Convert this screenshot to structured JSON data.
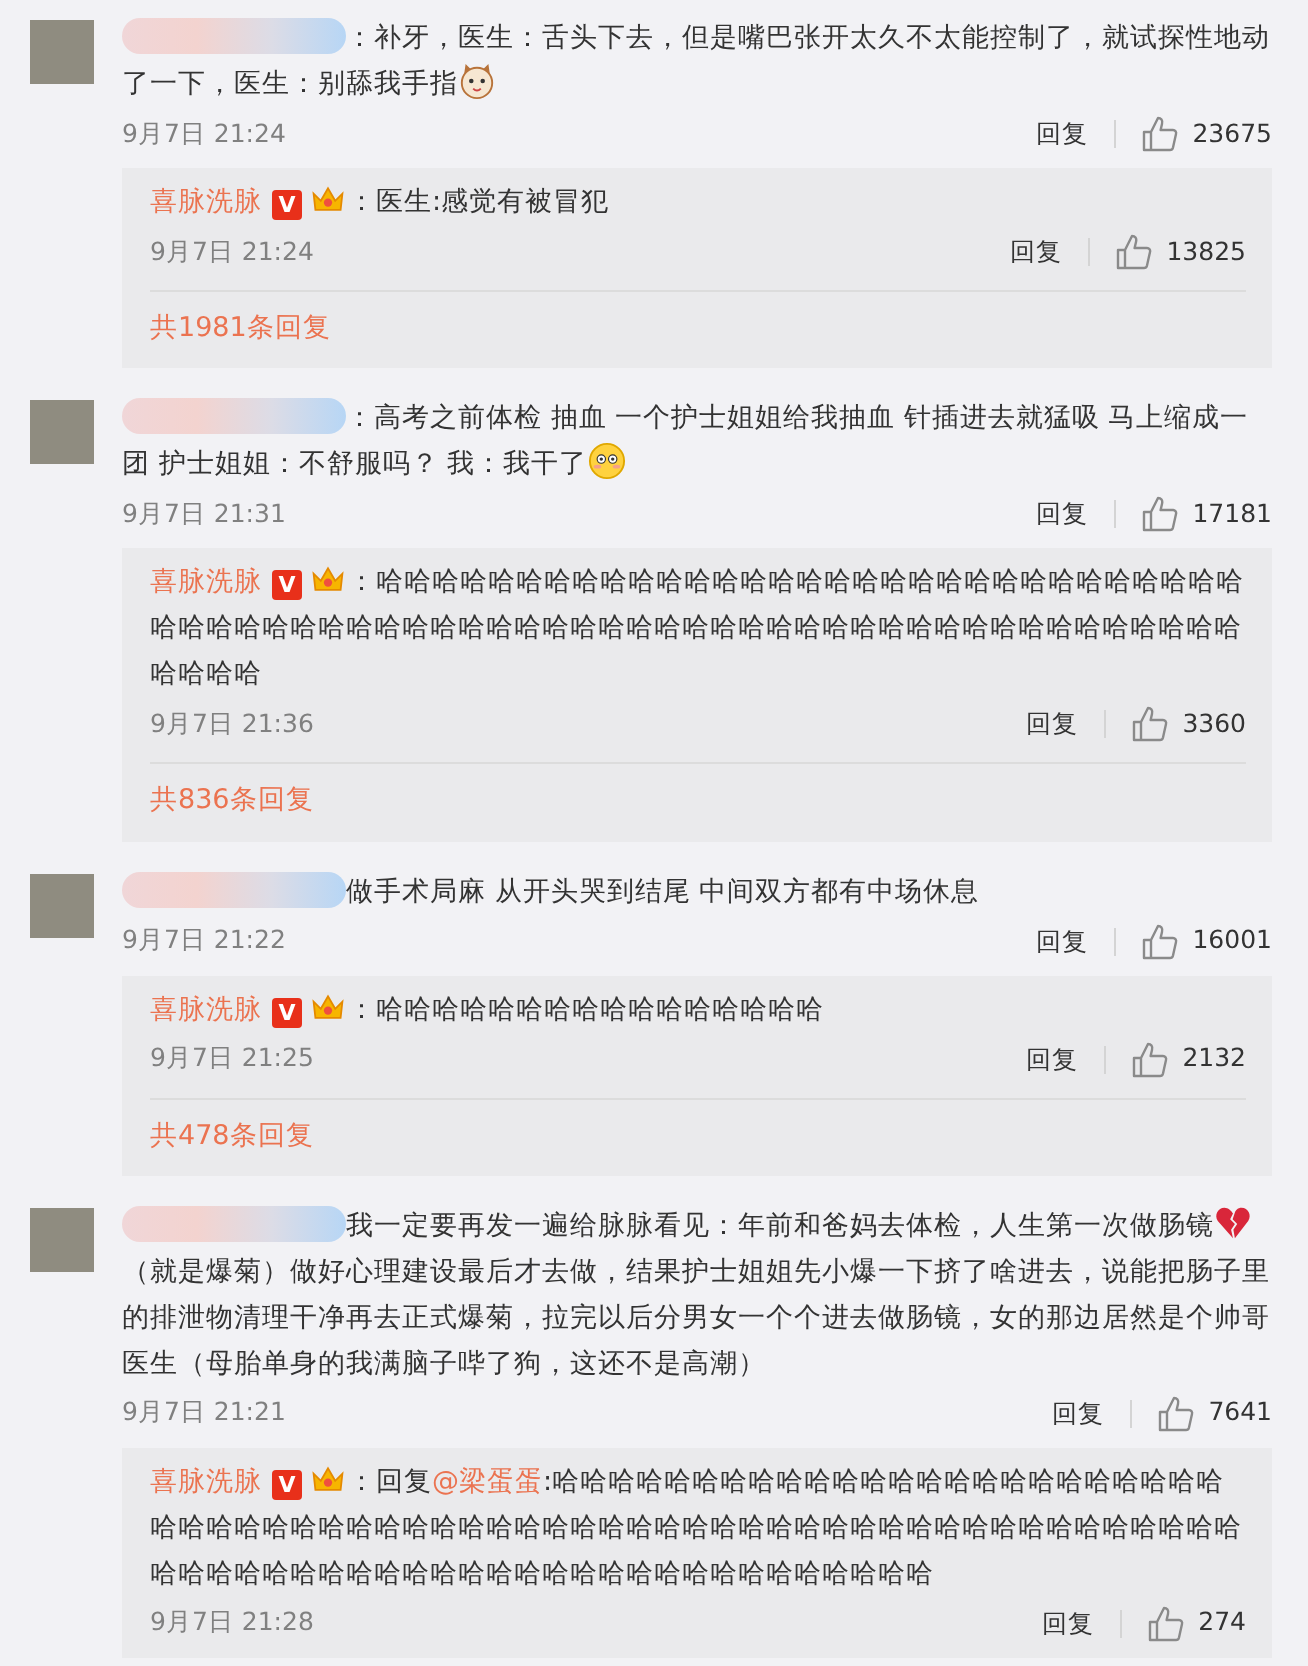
{
  "comments": [
    {
      "text": [
        {
          "kind": "text",
          "text": "：补牙，医生：舌头下去，但是嘴巴张开太久不太能控制了，就试探性地动了一下，医生：别舔我手指"
        },
        {
          "kind": "cat"
        }
      ],
      "time": "9月7日 21:24",
      "reply_label": "回复",
      "likes": "23675",
      "replies": [
        {
          "author": "喜脉洗脉",
          "badge": "V",
          "crown": true,
          "text": [
            {
              "kind": "text",
              "text": "：医生:感觉有被冒犯"
            }
          ],
          "time": "9月7日 21:24",
          "reply_label": "回复",
          "likes": "13825"
        }
      ],
      "more": "共1981条回复"
    },
    {
      "text": [
        {
          "kind": "text",
          "text": "：高考之前体检 抽血 一个护士姐姐给我抽血 针插进去就猛吸 马上缩成一团 护士姐姐：不舒服吗？ 我：我干了"
        },
        {
          "kind": "flushed"
        }
      ],
      "time": "9月7日 21:31",
      "reply_label": "回复",
      "likes": "17181",
      "replies": [
        {
          "author": "喜脉洗脉",
          "badge": "V",
          "crown": true,
          "text": [
            {
              "kind": "text",
              "text": "：哈哈哈哈哈哈哈哈哈哈哈哈哈哈哈哈哈哈哈哈哈哈哈哈哈哈哈哈哈哈哈哈哈哈哈哈哈哈哈哈哈哈哈哈哈哈哈哈哈哈哈哈哈哈哈哈哈哈哈哈哈哈哈哈哈哈哈哈哈哈哈哈哈哈"
            }
          ],
          "time": "9月7日 21:36",
          "reply_label": "回复",
          "likes": "3360"
        }
      ],
      "more": "共836条回复"
    },
    {
      "text": [
        {
          "kind": "text",
          "text": "做手术局麻 从开头哭到结尾 中间双方都有中场休息"
        }
      ],
      "time": "9月7日 21:22",
      "reply_label": "回复",
      "likes": "16001",
      "replies": [
        {
          "author": "喜脉洗脉",
          "badge": "V",
          "crown": true,
          "text": [
            {
              "kind": "text",
              "text": "：哈哈哈哈哈哈哈哈哈哈哈哈哈哈哈哈"
            }
          ],
          "time": "9月7日 21:25",
          "reply_label": "回复",
          "likes": "2132"
        }
      ],
      "more": "共478条回复"
    },
    {
      "text": [
        {
          "kind": "text",
          "text": "我一定要再发一遍给脉脉看见：年前和爸妈去体检，人生第一次做肠镜"
        },
        {
          "kind": "heartbreak"
        },
        {
          "kind": "text",
          "text": "（就是爆菊）做好心理建设最后才去做，结果护士姐姐先小爆一下挤了啥进去，说能把肠子里的排泄物清理干净再去正式爆菊，拉完以后分男女一个个进去做肠镜，女的那边居然是个帅哥医生（母胎单身的我满脑子哔了狗，这还不是高潮）"
        }
      ],
      "time": "9月7日 21:21",
      "reply_label": "回复",
      "likes": "7641",
      "replies": [
        {
          "author": "喜脉洗脉",
          "badge": "V",
          "crown": true,
          "text": [
            {
              "kind": "text",
              "text": "：回复"
            },
            {
              "kind": "mention",
              "text": "@梁蛋蛋"
            },
            {
              "kind": "text",
              "text": ":哈哈哈哈哈哈哈哈哈哈哈哈哈哈哈哈哈哈哈哈哈哈哈哈哈哈哈哈哈哈哈哈哈哈哈哈哈哈哈哈哈哈哈哈哈哈哈哈哈哈哈哈哈哈哈哈哈哈哈哈哈哈哈哈哈哈哈哈哈哈哈哈哈哈哈哈哈哈哈哈哈哈哈哈哈哈哈哈哈哈哈"
            }
          ],
          "time": "9月7日 21:28",
          "reply_label": "回复",
          "likes": "274"
        }
      ]
    }
  ]
}
